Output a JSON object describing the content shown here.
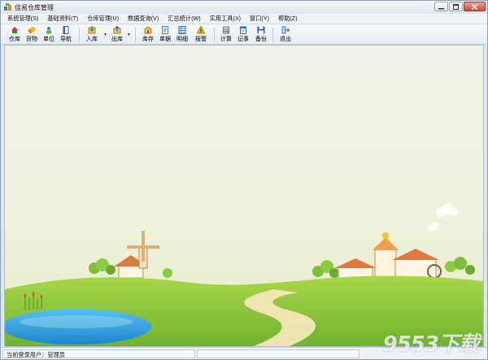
{
  "window": {
    "title": "佳易仓库管理",
    "icon": "app-logo-icon"
  },
  "menu": [
    "系统管理(S)",
    "基础资料(T)",
    "仓库管理(U)",
    "数据查询(V)",
    "汇总统计(W)",
    "实用工具(X)",
    "窗口(Y)",
    "帮助(Z)"
  ],
  "toolbar": {
    "buttons": [
      {
        "label": "仓库",
        "icon": "warehouse-icon"
      },
      {
        "label": "货物",
        "icon": "goods-icon"
      },
      {
        "label": "单位",
        "icon": "unit-icon"
      },
      {
        "label": "导航",
        "icon": "navigation-icon"
      },
      {
        "label": "入库",
        "icon": "stock-in-icon"
      },
      {
        "label": "出库",
        "icon": "stock-out-icon"
      },
      {
        "label": "库存",
        "icon": "inventory-icon"
      },
      {
        "label": "单据",
        "icon": "document-icon"
      },
      {
        "label": "明细",
        "icon": "details-icon"
      },
      {
        "label": "报警",
        "icon": "alarm-icon"
      },
      {
        "label": "计算",
        "icon": "calculator-icon"
      },
      {
        "label": "记事",
        "icon": "notepad-icon"
      },
      {
        "label": "备份",
        "icon": "backup-icon"
      },
      {
        "label": "退出",
        "icon": "exit-icon"
      }
    ]
  },
  "status": {
    "current_user": "当前登录用户：管理员"
  },
  "watermark": "9553下载",
  "colors": {
    "sky": "#eef1dc",
    "grass": "#8cc63f",
    "lake": "#3aa6e0",
    "path": "#f3e7b8"
  }
}
